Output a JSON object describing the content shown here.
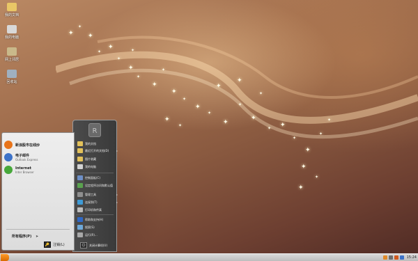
{
  "desktop": {
    "icons": [
      {
        "label": "我的文档",
        "icon": "folder-icon",
        "color": "#e9c766"
      },
      {
        "label": "我的电脑",
        "icon": "computer-icon",
        "color": "#d8d8d8"
      },
      {
        "label": "网上邻居",
        "icon": "network-icon",
        "color": "#c9b98a"
      },
      {
        "label": "回收站",
        "icon": "recycle-bin-icon",
        "color": "#9fb0c0"
      }
    ]
  },
  "start_menu": {
    "left": {
      "pinned": [
        {
          "title": "新浪股市在线炒",
          "subtitle": "",
          "icon": "stock-app-icon",
          "color": "#e8741a"
        },
        {
          "title": "电子邮件",
          "subtitle": "Outlook Express",
          "icon": "mail-icon",
          "color": "#3d73c9"
        },
        {
          "title": "Internet",
          "subtitle": "Inter Browser",
          "icon": "browser-icon",
          "color": "#47a83a"
        }
      ],
      "all_programs": "所有程序(P)",
      "all_programs_arrow": "➤",
      "logoff_label": "注销(L)"
    },
    "right": {
      "items": [
        {
          "label": "我的文档",
          "icon": "documents-icon",
          "color": "#e3c15a",
          "arrow": ""
        },
        {
          "label": "最近打开的文档(D)",
          "icon": "recent-docs-icon",
          "color": "#e3c15a",
          "arrow": "▸"
        },
        {
          "label": "图片收藏",
          "icon": "pictures-icon",
          "color": "#e3c15a",
          "arrow": ""
        },
        {
          "label": "我的电脑",
          "icon": "my-computer-icon",
          "color": "#d2d2d2",
          "arrow": ""
        },
        {
          "label": "控制面板(C)",
          "icon": "control-panel-icon",
          "color": "#6d8fc6",
          "arrow": ""
        },
        {
          "label": "设定程序访问和默认值",
          "icon": "defaults-icon",
          "color": "#5aa24e",
          "arrow": ""
        },
        {
          "label": "管理工具",
          "icon": "admin-tools-icon",
          "color": "#8f8f8f",
          "arrow": "▸"
        },
        {
          "label": "连接到(T)",
          "icon": "connect-icon",
          "color": "#3e9bd6",
          "arrow": "▸"
        },
        {
          "label": "打印机和传真",
          "icon": "printer-icon",
          "color": "#bcbcbc",
          "arrow": ""
        },
        {
          "label": "帮助和支持(H)",
          "icon": "help-icon",
          "color": "#2e67c4",
          "arrow": ""
        },
        {
          "label": "搜索(S)",
          "icon": "search-icon",
          "color": "#6ea8d9",
          "arrow": ""
        },
        {
          "label": "运行(R)...",
          "icon": "run-icon",
          "color": "#a8a8a8",
          "arrow": ""
        }
      ],
      "shutdown_label": "关闭计算机(U)"
    }
  },
  "taskbar": {
    "clock": "15:24"
  }
}
